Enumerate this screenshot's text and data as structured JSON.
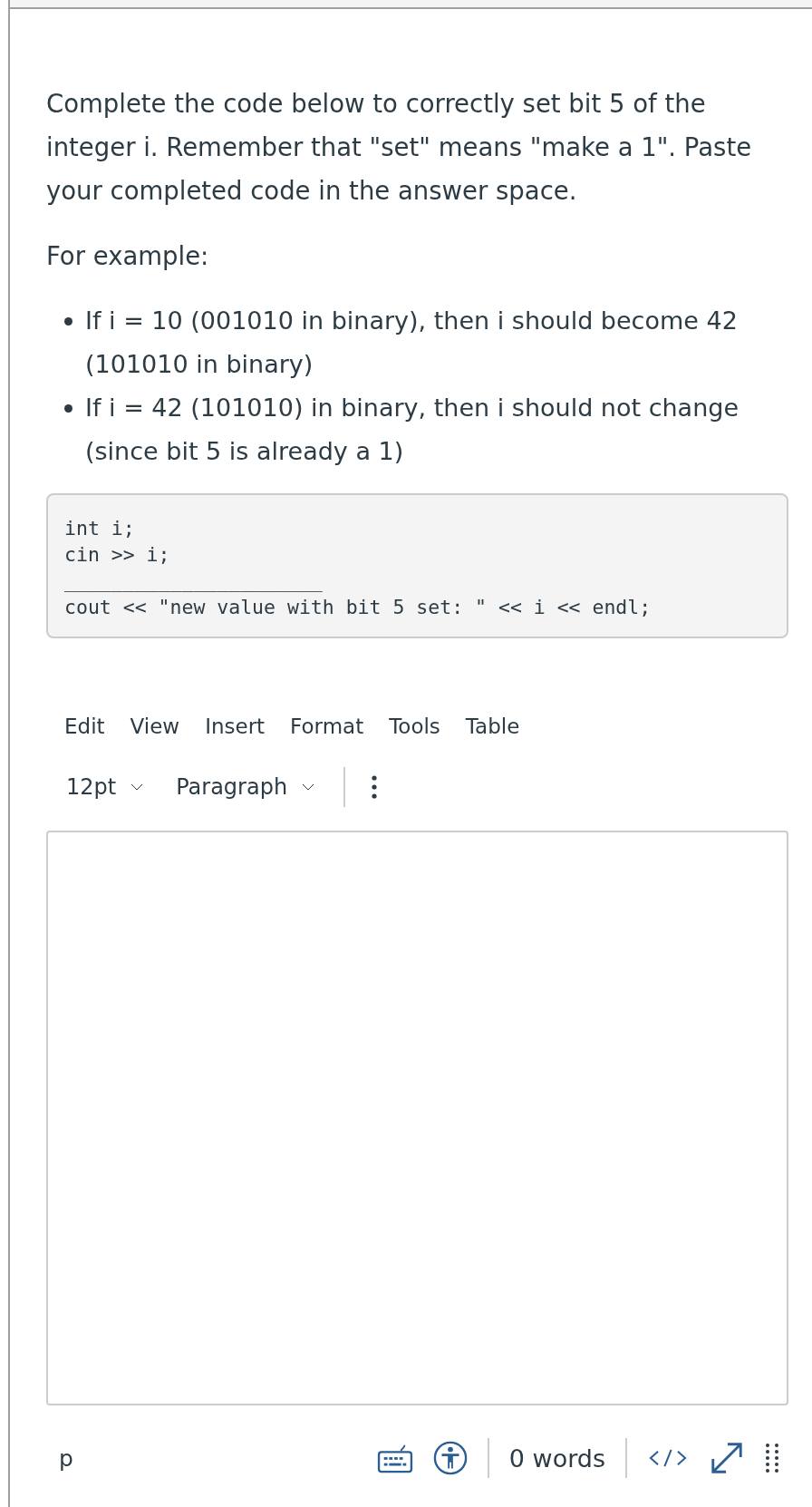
{
  "question": {
    "paragraphs": [
      "Complete the code below to correctly set bit 5 of the integer i. Remember that \"set\" means \"make a 1\". Paste your completed code in the answer space.",
      "For example:"
    ],
    "bullets": [
      "If i = 10 (001010 in binary), then i should become 42 (101010 in binary)",
      "If i = 42 (101010) in binary, then i should not change (since bit 5 is already a 1)"
    ],
    "code_lines": [
      "int i;",
      "cin >> i;",
      "______________________",
      "cout << \"new value with bit 5 set: \" << i << endl;"
    ]
  },
  "editor": {
    "menu": [
      "Edit",
      "View",
      "Insert",
      "Format",
      "Tools",
      "Table"
    ],
    "font_size": "12pt",
    "block_format": "Paragraph",
    "status_bar": {
      "path": "p",
      "word_count": "0 words"
    }
  }
}
